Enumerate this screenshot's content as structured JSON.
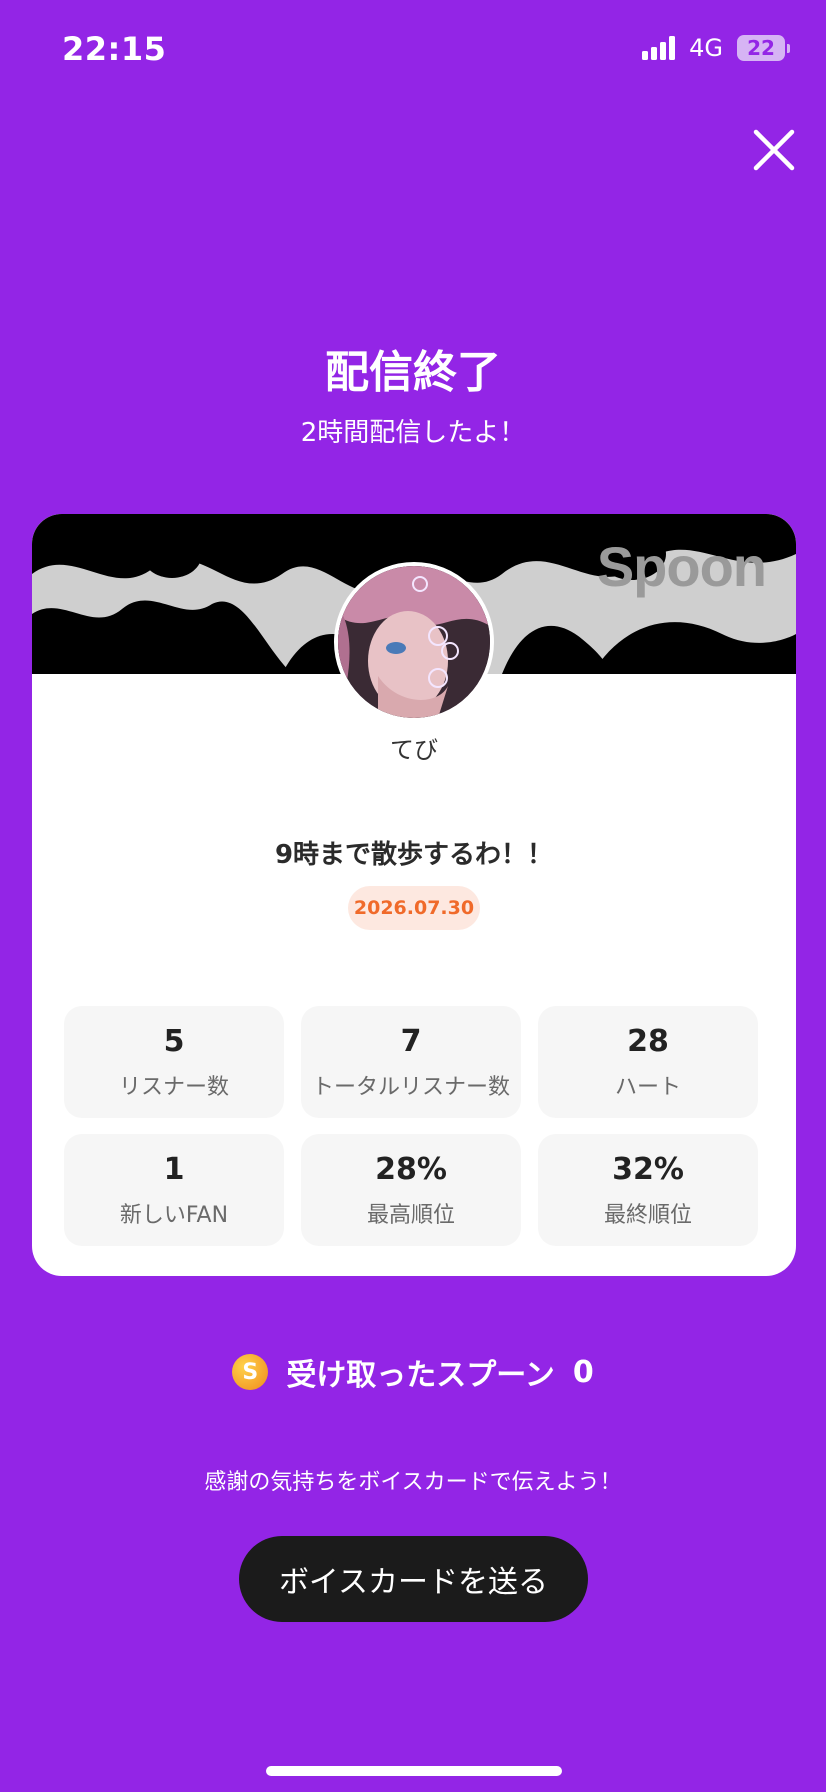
{
  "status_bar": {
    "time": "22:15",
    "network": "4G",
    "battery": "22"
  },
  "header": {
    "title": "配信終了",
    "subtitle": "2時間配信したよ！"
  },
  "card": {
    "brand": "Spoon",
    "username": "てび",
    "live_title": "9時まで散歩するわ！！",
    "date": "2026.07.30",
    "stats": [
      {
        "value": "5",
        "label": "リスナー数"
      },
      {
        "value": "7",
        "label": "トータルリスナー数"
      },
      {
        "value": "28",
        "label": "ハート"
      },
      {
        "value": "1",
        "label": "新しいFAN"
      },
      {
        "value": "28%",
        "label": "最高順位"
      },
      {
        "value": "32%",
        "label": "最終順位"
      }
    ]
  },
  "spoons": {
    "coin_symbol": "S",
    "label": "受け取ったスプーン",
    "count": "0"
  },
  "footer": {
    "message": "感謝の気持ちをボイスカードで伝えよう！",
    "button_label": "ボイスカードを送る"
  },
  "colors": {
    "background": "#9325e6",
    "date_text": "#f06a2a",
    "button": "#1b1b1b"
  }
}
